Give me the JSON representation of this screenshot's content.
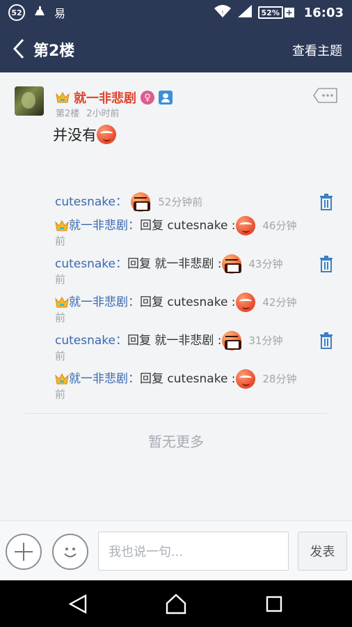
{
  "status_bar": {
    "notif_count": "52",
    "notif_app": "易",
    "battery": "52%",
    "battery_plus": "+",
    "time": "16:03"
  },
  "header": {
    "title": "第2楼",
    "view_topic": "查看主题"
  },
  "post": {
    "author": "就一非悲剧",
    "gender_symbol": "♀",
    "floor": "第2楼",
    "time_ago": "2小时前",
    "text": "并没有"
  },
  "comments": [
    {
      "user": "cutesnake",
      "sep": "：",
      "reply_word": "",
      "reply_to": "",
      "time": "52分钟前",
      "time_rest": "",
      "emoji": "grin-icon",
      "deletable": true
    },
    {
      "user": "就一非悲剧",
      "sep": "：",
      "reply_word": "回复 ",
      "reply_to": "cutesnake",
      "time": "46分钟",
      "time_rest": "前",
      "emoji": "smirk-icon",
      "deletable": false
    },
    {
      "user": "cutesnake",
      "sep": "：",
      "reply_word": "回复 ",
      "reply_to": "就一非悲剧",
      "time": "43分钟",
      "time_rest": "前",
      "emoji": "grin-icon",
      "deletable": true
    },
    {
      "user": "就一非悲剧",
      "sep": "：",
      "reply_word": "回复 ",
      "reply_to": "cutesnake",
      "time": "42分钟",
      "time_rest": "前",
      "emoji": "smirk-icon",
      "deletable": false
    },
    {
      "user": "cutesnake",
      "sep": "：",
      "reply_word": "回复 ",
      "reply_to": "就一非悲剧",
      "time": "31分钟",
      "time_rest": "前",
      "emoji": "grin-icon",
      "deletable": true
    },
    {
      "user": "就一非悲剧",
      "sep": "：",
      "reply_word": "回复 ",
      "reply_to": "cutesnake",
      "time": "28分钟",
      "time_rest": "前",
      "emoji": "smirk-icon",
      "deletable": false
    }
  ],
  "no_more": "暂无更多",
  "composer": {
    "placeholder": "我也说一句...",
    "send_label": "发表"
  },
  "colors": {
    "header_bg": "#2b3957",
    "author_red": "#e0442b",
    "link_blue": "#3a68b0"
  }
}
